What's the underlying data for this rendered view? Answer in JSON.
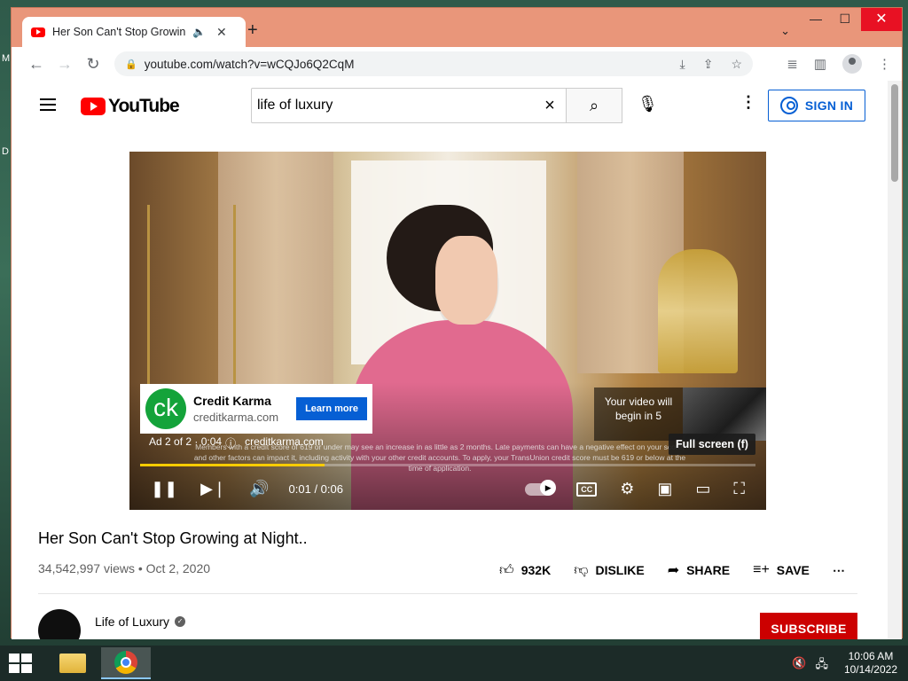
{
  "desktop": {
    "edge_top": "M",
    "edge_mid": "D"
  },
  "browser": {
    "tab_title": "Her Son Can't Stop Growing at Night..",
    "url": "youtube.com/watch?v=wCQJo6Q2CqM",
    "win_minimize": "—",
    "win_maximize": "☐",
    "win_close": "✕"
  },
  "youtube": {
    "search_value": "life of luxury",
    "sign_in_label": "SIGN IN",
    "logo_text": "YouTube"
  },
  "ad": {
    "advertiser": "Credit Karma",
    "domain": "creditkarma.com",
    "logo_text": "ck",
    "cta": "Learn more",
    "ad_counter": "Ad 2 of 2 · 0:04",
    "ad_link": "creditkarma.com",
    "disclaimer": "Members with a credit score of 619 or under may see an increase in as little as 2 months. Late payments can have a negative effect on your score, and other factors can impact it, including activity with your other credit accounts. To apply, your TransUnion credit score must be 619 or below at the time of application.",
    "preview_text": "Your video will begin in 5",
    "tooltip": "Full screen (f)"
  },
  "player": {
    "time": "0:01 / 0:06",
    "progress_fraction": 0.3,
    "cc_label": "CC"
  },
  "video": {
    "title": "Her Son Can't Stop Growing at Night..",
    "views": "34,542,997 views",
    "date": "Oct 2, 2020",
    "likes": "932K",
    "dislike_label": "DISLIKE",
    "share_label": "SHARE",
    "save_label": "SAVE"
  },
  "channel": {
    "name": "Life of Luxury",
    "subscribe_label": "SUBSCRIBE"
  },
  "taskbar": {
    "time": "10:06 AM",
    "date": "10/14/2022"
  },
  "colors": {
    "accent_blue": "#065fd4",
    "youtube_red": "#ff0000",
    "progress_yellow": "#ffcc00",
    "window_frame": "#e9967a"
  }
}
